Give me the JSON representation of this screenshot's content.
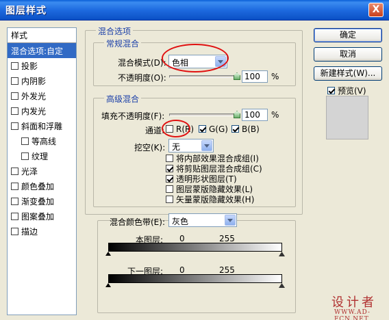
{
  "window": {
    "title": "图层样式",
    "close_label": "X"
  },
  "sidebar": {
    "header": "样式",
    "items": [
      {
        "label": "混合选项:自定",
        "has_checkbox": false,
        "selected": true,
        "indent": false
      },
      {
        "label": "投影",
        "has_checkbox": true,
        "selected": false,
        "indent": false
      },
      {
        "label": "内阴影",
        "has_checkbox": true,
        "selected": false,
        "indent": false
      },
      {
        "label": "外发光",
        "has_checkbox": true,
        "selected": false,
        "indent": false
      },
      {
        "label": "内发光",
        "has_checkbox": true,
        "selected": false,
        "indent": false
      },
      {
        "label": "斜面和浮雕",
        "has_checkbox": true,
        "selected": false,
        "indent": false
      },
      {
        "label": "等高线",
        "has_checkbox": true,
        "selected": false,
        "indent": true
      },
      {
        "label": "纹理",
        "has_checkbox": true,
        "selected": false,
        "indent": true
      },
      {
        "label": "光泽",
        "has_checkbox": true,
        "selected": false,
        "indent": false
      },
      {
        "label": "颜色叠加",
        "has_checkbox": true,
        "selected": false,
        "indent": false
      },
      {
        "label": "渐变叠加",
        "has_checkbox": true,
        "selected": false,
        "indent": false
      },
      {
        "label": "图案叠加",
        "has_checkbox": true,
        "selected": false,
        "indent": false
      },
      {
        "label": "描边",
        "has_checkbox": true,
        "selected": false,
        "indent": false
      }
    ]
  },
  "blend_options": {
    "group_label": "混合选项",
    "general": {
      "group_label": "常规混合",
      "mode_label": "混合模式(D):",
      "mode_value": "色相",
      "opacity_label": "不透明度(O):",
      "opacity_value": "100",
      "opacity_unit": "%",
      "opacity_level": 1.0
    },
    "advanced": {
      "group_label": "高级混合",
      "fill_label": "填充不透明度(F):",
      "fill_value": "100",
      "fill_unit": "%",
      "fill_level": 1.0,
      "channels_label": "通道:",
      "channels": [
        {
          "label": "R(R)",
          "checked": false
        },
        {
          "label": "G(G)",
          "checked": true
        },
        {
          "label": "B(B)",
          "checked": true
        }
      ],
      "knockout_label": "挖空(K):",
      "knockout_value": "无",
      "options": [
        {
          "label": "将内部效果混合成组(I)",
          "checked": false
        },
        {
          "label": "将剪贴图层混合成组(C)",
          "checked": true
        },
        {
          "label": "透明形状图层(T)",
          "checked": true
        },
        {
          "label": "图层蒙版隐藏效果(L)",
          "checked": false
        },
        {
          "label": "矢量蒙版隐藏效果(H)",
          "checked": false
        }
      ]
    },
    "blend_if": {
      "label": "混合颜色带(E):",
      "value": "灰色",
      "this_layer_label": "本图层:",
      "this_layer_low": "0",
      "this_layer_high": "255",
      "under_layer_label": "下一图层:",
      "under_layer_low": "0",
      "under_layer_high": "255"
    }
  },
  "buttons": {
    "ok": "确定",
    "cancel": "取消",
    "new_style": "新建样式(W)...",
    "preview_label": "预览(V)",
    "preview_checked": true
  },
  "watermark": {
    "big": "设计者",
    "small": "WWW.AD-FCN.NET"
  },
  "colors": {
    "accent": "#316AC5",
    "group_label": "#1A3FA8",
    "highlight_ring": "#E01010",
    "titlebar": "#0A5FD8"
  }
}
